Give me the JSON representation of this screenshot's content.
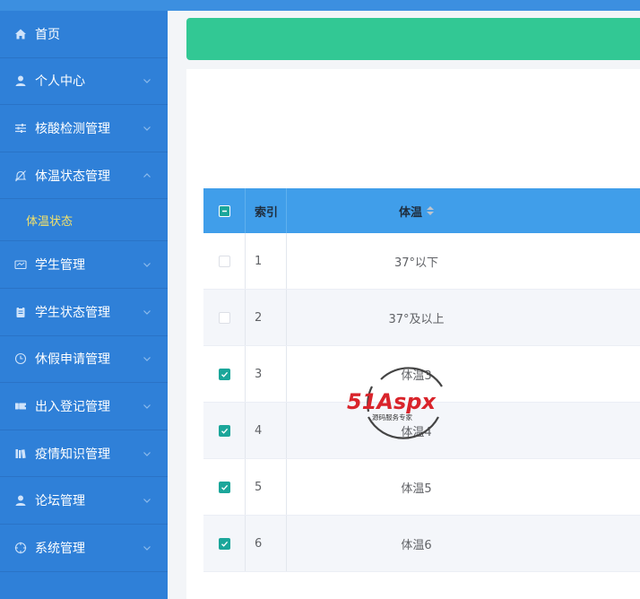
{
  "sidebar": {
    "items": [
      {
        "label": "首页",
        "icon": "home-icon"
      },
      {
        "label": "个人中心",
        "icon": "user-icon"
      },
      {
        "label": "核酸检测管理",
        "icon": "sliders-icon"
      },
      {
        "label": "体温状态管理",
        "icon": "bell-off-icon"
      },
      {
        "label": "学生管理",
        "icon": "card-icon"
      },
      {
        "label": "学生状态管理",
        "icon": "clipboard-icon"
      },
      {
        "label": "休假申请管理",
        "icon": "clock-icon"
      },
      {
        "label": "出入登记管理",
        "icon": "ticket-icon"
      },
      {
        "label": "疫情知识管理",
        "icon": "books-icon"
      },
      {
        "label": "论坛管理",
        "icon": "user-icon"
      },
      {
        "label": "系统管理",
        "icon": "target-icon"
      }
    ],
    "submenu_label": "体温状态",
    "active_sub_color": "#f4e26a"
  },
  "table": {
    "headers": {
      "index": "索引",
      "temp": "体温"
    },
    "rows": [
      {
        "index": "1",
        "temp": "37°以下",
        "checked": false
      },
      {
        "index": "2",
        "temp": "37°及以上",
        "checked": false
      },
      {
        "index": "3",
        "temp": "体温3",
        "checked": true
      },
      {
        "index": "4",
        "temp": "体温4",
        "checked": true
      },
      {
        "index": "5",
        "temp": "体温5",
        "checked": true
      },
      {
        "index": "6",
        "temp": "体温6",
        "checked": true
      }
    ]
  },
  "watermark": {
    "brand": "51Aspx",
    "tagline": "源码服务专家"
  },
  "colors": {
    "sidebar": "#2f80d8",
    "header": "#409eea",
    "banner": "#32c894",
    "checkbox": "#1ba69a"
  }
}
